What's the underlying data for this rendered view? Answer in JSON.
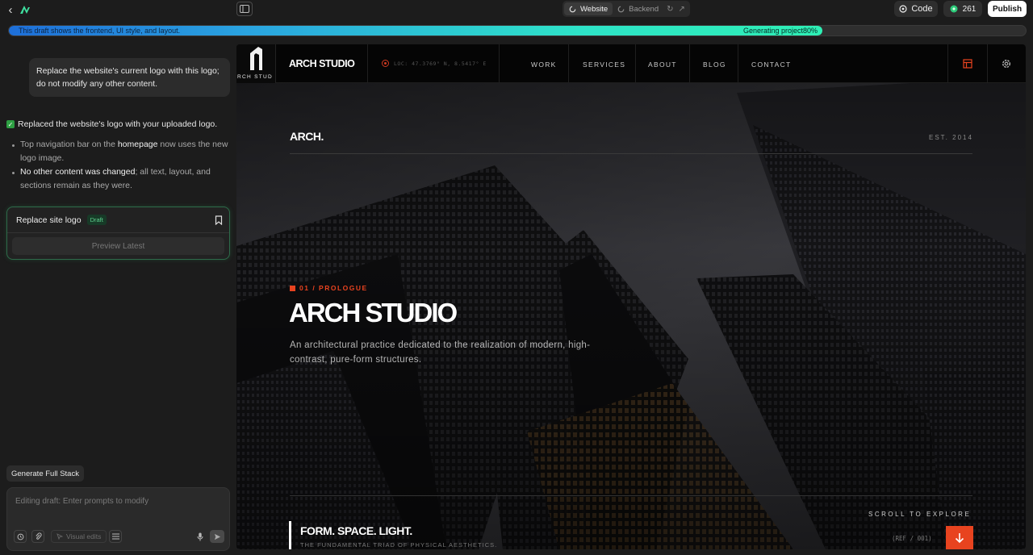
{
  "topbar": {
    "tabs": [
      {
        "label": "Website",
        "active": true
      },
      {
        "label": "Backend",
        "active": false
      }
    ],
    "code_label": "Code",
    "credits": "261",
    "publish_label": "Publish"
  },
  "progress": {
    "message": "This draft shows the frontend, UI style, and layout.",
    "status": "Generating project80%",
    "fraction": 0.8
  },
  "chat": {
    "user_message": "Replace the website's current logo with this logo; do not modify any other content.",
    "reply_title": "Replaced the website's logo with your uploaded logo.",
    "bullets": [
      {
        "pre": "Top navigation bar on the ",
        "bold": "homepage",
        "post": " now uses the new logo image."
      },
      {
        "pre": "",
        "bold": "No other content was changed",
        "post": "; all text, layout, and sections remain as they were."
      }
    ],
    "card": {
      "title": "Replace site logo",
      "badge": "Draft",
      "preview_label": "Preview Latest"
    },
    "generate_label": "Generate Full Stack",
    "input_placeholder": "Editing draft: Enter prompts to modify",
    "visual_edits_label": "Visual edits"
  },
  "site": {
    "brand": "ARCH STUDIO",
    "logo_letters": "RCH STUD",
    "location": "LOC: 47.3769° N, 8.5417° E",
    "nav": [
      "WORK",
      "SERVICES",
      "ABOUT",
      "BLOG",
      "CONTACT"
    ],
    "hero_top": "ARCH.",
    "est": "EST. 2014",
    "prologue": "01 / PROLOGUE",
    "hero_title": "ARCH STUDIO",
    "hero_sub": "An architectural practice dedicated to the realization of modern, high-contrast, pure-form structures.",
    "scroll": "SCROLL TO EXPLORE",
    "ref": "(REF / 001)",
    "triad_title": "FORM. SPACE. LIGHT.",
    "triad_sub": "THE FUNDAMENTAL TRIAD OF PHYSICAL AESTHETICS."
  },
  "colors": {
    "accent": "#e8431f",
    "draft_green": "#5ed08e",
    "publish_bg": "#ffffff"
  }
}
